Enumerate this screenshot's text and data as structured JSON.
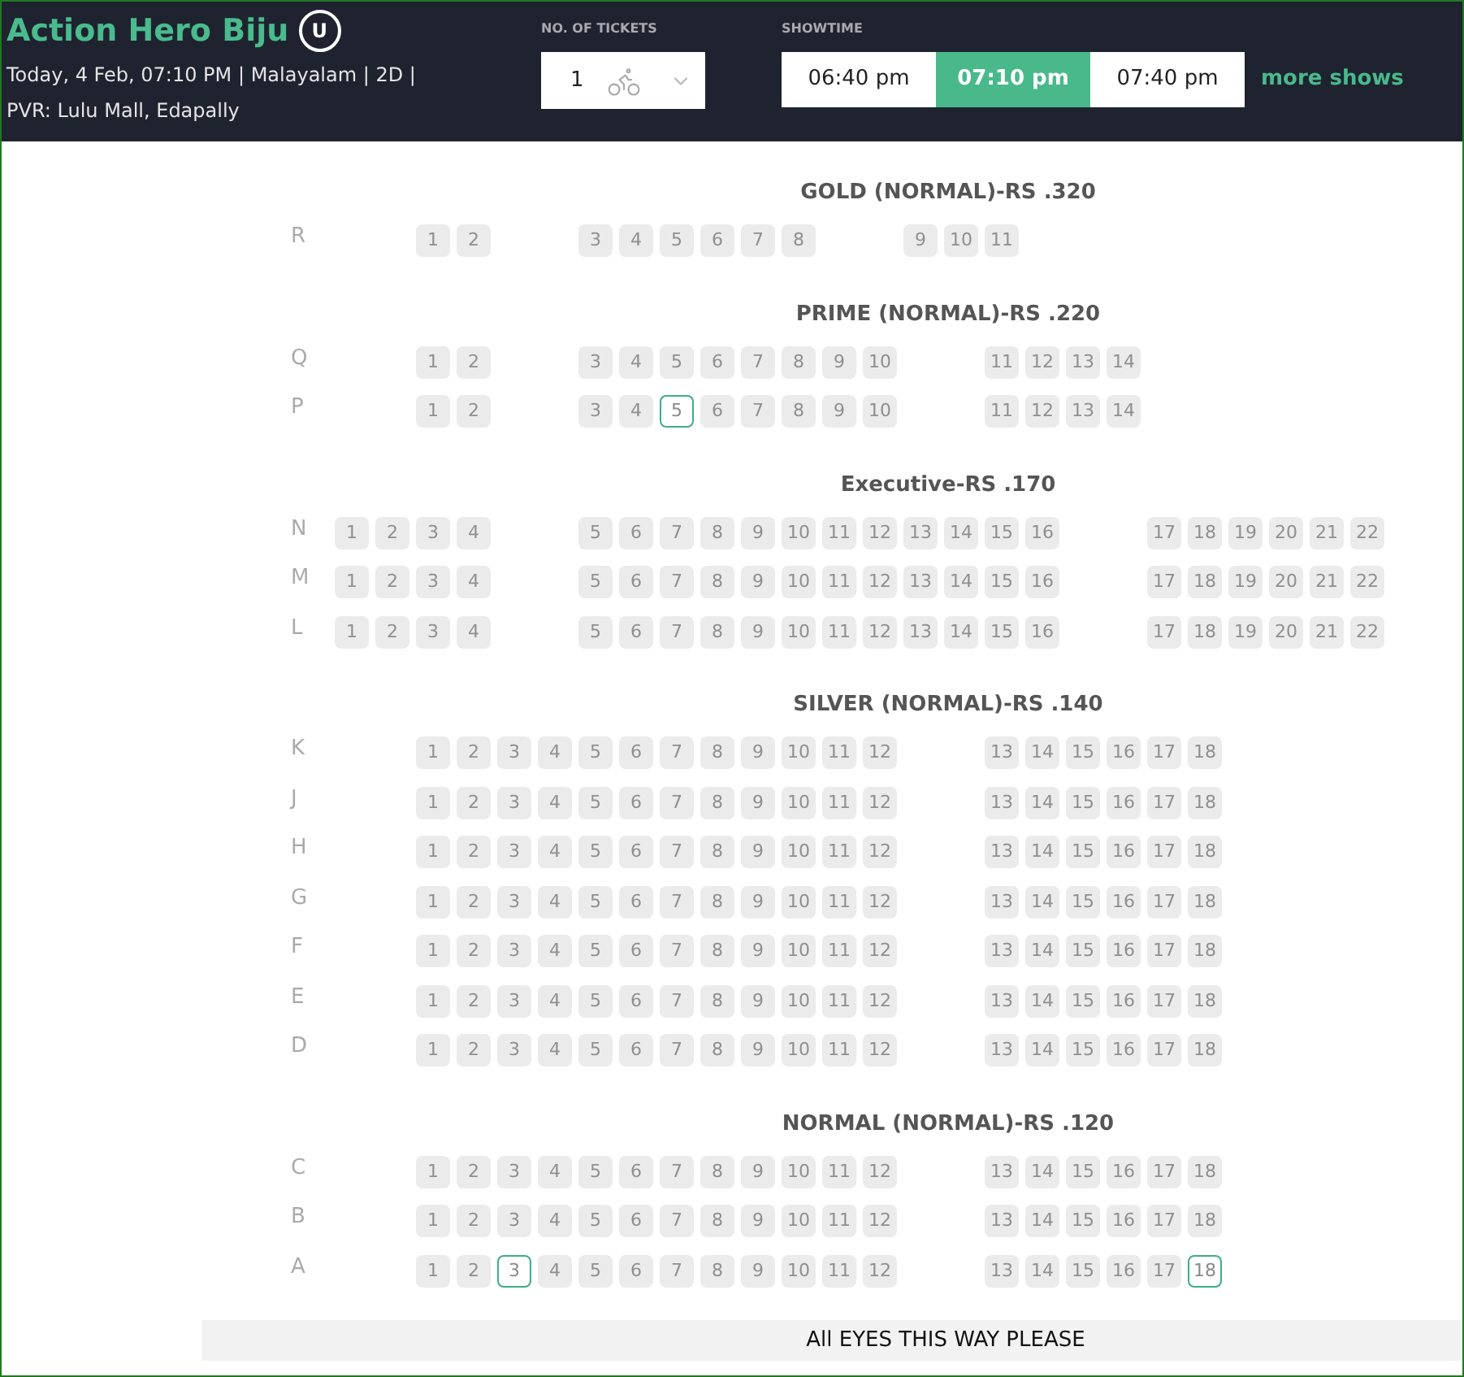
{
  "movie": {
    "title": "Action Hero Biju",
    "rating": "U",
    "details": "Today, 4 Feb, 07:10 PM | Malayalam | 2D |",
    "venue": "PVR: Lulu Mall, Edapally"
  },
  "tickets": {
    "label": "NO. OF TICKETS",
    "value": "1"
  },
  "showtime": {
    "label": "SHOWTIME",
    "times": [
      {
        "label": "06:40 pm",
        "selected": false
      },
      {
        "label": "07:10 pm",
        "selected": true
      },
      {
        "label": "07:40 pm",
        "selected": false
      }
    ],
    "more": "more shows"
  },
  "sections": [
    {
      "title": "GOLD (NORMAL)-RS .320",
      "rows": [
        {
          "label": "R",
          "blocks": [
            [
              {
                "n": "1",
                "available": false
              },
              {
                "n": "2",
                "available": false
              }
            ],
            [
              {
                "n": "3",
                "available": false
              },
              {
                "n": "4",
                "available": false
              },
              {
                "n": "5",
                "available": false
              },
              {
                "n": "6",
                "available": false
              },
              {
                "n": "7",
                "available": false
              },
              {
                "n": "8",
                "available": false
              }
            ],
            [
              {
                "n": "9",
                "available": false
              },
              {
                "n": "10",
                "available": false
              },
              {
                "n": "11",
                "available": false
              }
            ]
          ]
        }
      ]
    },
    {
      "title": "PRIME (NORMAL)-RS .220",
      "rows": [
        {
          "label": "Q",
          "blocks": [
            [
              {
                "n": "1",
                "available": false
              },
              {
                "n": "2",
                "available": false
              }
            ],
            [
              {
                "n": "3",
                "available": false
              },
              {
                "n": "4",
                "available": false
              },
              {
                "n": "5",
                "available": false
              },
              {
                "n": "6",
                "available": false
              },
              {
                "n": "7",
                "available": false
              },
              {
                "n": "8",
                "available": false
              },
              {
                "n": "9",
                "available": false
              },
              {
                "n": "10",
                "available": false
              }
            ],
            [
              {
                "n": "11",
                "available": false
              },
              {
                "n": "12",
                "available": false
              },
              {
                "n": "13",
                "available": false
              },
              {
                "n": "14",
                "available": false
              }
            ]
          ]
        },
        {
          "label": "P",
          "blocks": [
            [
              {
                "n": "1",
                "available": false
              },
              {
                "n": "2",
                "available": false
              }
            ],
            [
              {
                "n": "3",
                "available": false
              },
              {
                "n": "4",
                "available": false
              },
              {
                "n": "5",
                "available": true
              },
              {
                "n": "6",
                "available": false
              },
              {
                "n": "7",
                "available": false
              },
              {
                "n": "8",
                "available": false
              },
              {
                "n": "9",
                "available": false
              },
              {
                "n": "10",
                "available": false
              }
            ],
            [
              {
                "n": "11",
                "available": false
              },
              {
                "n": "12",
                "available": false
              },
              {
                "n": "13",
                "available": false
              },
              {
                "n": "14",
                "available": false
              }
            ]
          ]
        }
      ]
    },
    {
      "title": "Executive-RS .170",
      "rows": [
        {
          "label": "N",
          "blocks": [
            [
              {
                "n": "1",
                "available": false
              },
              {
                "n": "2",
                "available": false
              },
              {
                "n": "3",
                "available": false
              },
              {
                "n": "4",
                "available": false
              }
            ],
            [
              {
                "n": "5",
                "available": false
              },
              {
                "n": "6",
                "available": false
              },
              {
                "n": "7",
                "available": false
              },
              {
                "n": "8",
                "available": false
              },
              {
                "n": "9",
                "available": false
              },
              {
                "n": "10",
                "available": false
              },
              {
                "n": "11",
                "available": false
              },
              {
                "n": "12",
                "available": false
              },
              {
                "n": "13",
                "available": false
              },
              {
                "n": "14",
                "available": false
              },
              {
                "n": "15",
                "available": false
              },
              {
                "n": "16",
                "available": false
              }
            ],
            [
              {
                "n": "17",
                "available": false
              },
              {
                "n": "18",
                "available": false
              },
              {
                "n": "19",
                "available": false
              },
              {
                "n": "20",
                "available": false
              },
              {
                "n": "21",
                "available": false
              },
              {
                "n": "22",
                "available": false
              }
            ]
          ]
        },
        {
          "label": "M",
          "blocks": [
            [
              {
                "n": "1",
                "available": false
              },
              {
                "n": "2",
                "available": false
              },
              {
                "n": "3",
                "available": false
              },
              {
                "n": "4",
                "available": false
              }
            ],
            [
              {
                "n": "5",
                "available": false
              },
              {
                "n": "6",
                "available": false
              },
              {
                "n": "7",
                "available": false
              },
              {
                "n": "8",
                "available": false
              },
              {
                "n": "9",
                "available": false
              },
              {
                "n": "10",
                "available": false
              },
              {
                "n": "11",
                "available": false
              },
              {
                "n": "12",
                "available": false
              },
              {
                "n": "13",
                "available": false
              },
              {
                "n": "14",
                "available": false
              },
              {
                "n": "15",
                "available": false
              },
              {
                "n": "16",
                "available": false
              }
            ],
            [
              {
                "n": "17",
                "available": false
              },
              {
                "n": "18",
                "available": false
              },
              {
                "n": "19",
                "available": false
              },
              {
                "n": "20",
                "available": false
              },
              {
                "n": "21",
                "available": false
              },
              {
                "n": "22",
                "available": false
              }
            ]
          ]
        },
        {
          "label": "L",
          "blocks": [
            [
              {
                "n": "1",
                "available": false
              },
              {
                "n": "2",
                "available": false
              },
              {
                "n": "3",
                "available": false
              },
              {
                "n": "4",
                "available": false
              }
            ],
            [
              {
                "n": "5",
                "available": false
              },
              {
                "n": "6",
                "available": false
              },
              {
                "n": "7",
                "available": false
              },
              {
                "n": "8",
                "available": false
              },
              {
                "n": "9",
                "available": false
              },
              {
                "n": "10",
                "available": false
              },
              {
                "n": "11",
                "available": false
              },
              {
                "n": "12",
                "available": false
              },
              {
                "n": "13",
                "available": false
              },
              {
                "n": "14",
                "available": false
              },
              {
                "n": "15",
                "available": false
              },
              {
                "n": "16",
                "available": false
              }
            ],
            [
              {
                "n": "17",
                "available": false
              },
              {
                "n": "18",
                "available": false
              },
              {
                "n": "19",
                "available": false
              },
              {
                "n": "20",
                "available": false
              },
              {
                "n": "21",
                "available": false
              },
              {
                "n": "22",
                "available": false
              }
            ]
          ]
        }
      ]
    },
    {
      "title": "SILVER (NORMAL)-RS .140",
      "rows": [
        {
          "label": "K",
          "blocks": [
            [
              {
                "n": "1",
                "available": false
              },
              {
                "n": "2",
                "available": false
              },
              {
                "n": "3",
                "available": false
              },
              {
                "n": "4",
                "available": false
              },
              {
                "n": "5",
                "available": false
              },
              {
                "n": "6",
                "available": false
              },
              {
                "n": "7",
                "available": false
              },
              {
                "n": "8",
                "available": false
              },
              {
                "n": "9",
                "available": false
              },
              {
                "n": "10",
                "available": false
              },
              {
                "n": "11",
                "available": false
              },
              {
                "n": "12",
                "available": false
              }
            ],
            [
              {
                "n": "13",
                "available": false
              },
              {
                "n": "14",
                "available": false
              },
              {
                "n": "15",
                "available": false
              },
              {
                "n": "16",
                "available": false
              },
              {
                "n": "17",
                "available": false
              },
              {
                "n": "18",
                "available": false
              }
            ]
          ]
        },
        {
          "label": "J",
          "blocks": [
            [
              {
                "n": "1",
                "available": false
              },
              {
                "n": "2",
                "available": false
              },
              {
                "n": "3",
                "available": false
              },
              {
                "n": "4",
                "available": false
              },
              {
                "n": "5",
                "available": false
              },
              {
                "n": "6",
                "available": false
              },
              {
                "n": "7",
                "available": false
              },
              {
                "n": "8",
                "available": false
              },
              {
                "n": "9",
                "available": false
              },
              {
                "n": "10",
                "available": false
              },
              {
                "n": "11",
                "available": false
              },
              {
                "n": "12",
                "available": false
              }
            ],
            [
              {
                "n": "13",
                "available": false
              },
              {
                "n": "14",
                "available": false
              },
              {
                "n": "15",
                "available": false
              },
              {
                "n": "16",
                "available": false
              },
              {
                "n": "17",
                "available": false
              },
              {
                "n": "18",
                "available": false
              }
            ]
          ]
        },
        {
          "label": "H",
          "blocks": [
            [
              {
                "n": "1",
                "available": false
              },
              {
                "n": "2",
                "available": false
              },
              {
                "n": "3",
                "available": false
              },
              {
                "n": "4",
                "available": false
              },
              {
                "n": "5",
                "available": false
              },
              {
                "n": "6",
                "available": false
              },
              {
                "n": "7",
                "available": false
              },
              {
                "n": "8",
                "available": false
              },
              {
                "n": "9",
                "available": false
              },
              {
                "n": "10",
                "available": false
              },
              {
                "n": "11",
                "available": false
              },
              {
                "n": "12",
                "available": false
              }
            ],
            [
              {
                "n": "13",
                "available": false
              },
              {
                "n": "14",
                "available": false
              },
              {
                "n": "15",
                "available": false
              },
              {
                "n": "16",
                "available": false
              },
              {
                "n": "17",
                "available": false
              },
              {
                "n": "18",
                "available": false
              }
            ]
          ]
        },
        {
          "label": "G",
          "blocks": [
            [
              {
                "n": "1",
                "available": false
              },
              {
                "n": "2",
                "available": false
              },
              {
                "n": "3",
                "available": false
              },
              {
                "n": "4",
                "available": false
              },
              {
                "n": "5",
                "available": false
              },
              {
                "n": "6",
                "available": false
              },
              {
                "n": "7",
                "available": false
              },
              {
                "n": "8",
                "available": false
              },
              {
                "n": "9",
                "available": false
              },
              {
                "n": "10",
                "available": false
              },
              {
                "n": "11",
                "available": false
              },
              {
                "n": "12",
                "available": false
              }
            ],
            [
              {
                "n": "13",
                "available": false
              },
              {
                "n": "14",
                "available": false
              },
              {
                "n": "15",
                "available": false
              },
              {
                "n": "16",
                "available": false
              },
              {
                "n": "17",
                "available": false
              },
              {
                "n": "18",
                "available": false
              }
            ]
          ]
        },
        {
          "label": "F",
          "blocks": [
            [
              {
                "n": "1",
                "available": false
              },
              {
                "n": "2",
                "available": false
              },
              {
                "n": "3",
                "available": false
              },
              {
                "n": "4",
                "available": false
              },
              {
                "n": "5",
                "available": false
              },
              {
                "n": "6",
                "available": false
              },
              {
                "n": "7",
                "available": false
              },
              {
                "n": "8",
                "available": false
              },
              {
                "n": "9",
                "available": false
              },
              {
                "n": "10",
                "available": false
              },
              {
                "n": "11",
                "available": false
              },
              {
                "n": "12",
                "available": false
              }
            ],
            [
              {
                "n": "13",
                "available": false
              },
              {
                "n": "14",
                "available": false
              },
              {
                "n": "15",
                "available": false
              },
              {
                "n": "16",
                "available": false
              },
              {
                "n": "17",
                "available": false
              },
              {
                "n": "18",
                "available": false
              }
            ]
          ]
        },
        {
          "label": "E",
          "blocks": [
            [
              {
                "n": "1",
                "available": false
              },
              {
                "n": "2",
                "available": false
              },
              {
                "n": "3",
                "available": false
              },
              {
                "n": "4",
                "available": false
              },
              {
                "n": "5",
                "available": false
              },
              {
                "n": "6",
                "available": false
              },
              {
                "n": "7",
                "available": false
              },
              {
                "n": "8",
                "available": false
              },
              {
                "n": "9",
                "available": false
              },
              {
                "n": "10",
                "available": false
              },
              {
                "n": "11",
                "available": false
              },
              {
                "n": "12",
                "available": false
              }
            ],
            [
              {
                "n": "13",
                "available": false
              },
              {
                "n": "14",
                "available": false
              },
              {
                "n": "15",
                "available": false
              },
              {
                "n": "16",
                "available": false
              },
              {
                "n": "17",
                "available": false
              },
              {
                "n": "18",
                "available": false
              }
            ]
          ]
        },
        {
          "label": "D",
          "blocks": [
            [
              {
                "n": "1",
                "available": false
              },
              {
                "n": "2",
                "available": false
              },
              {
                "n": "3",
                "available": false
              },
              {
                "n": "4",
                "available": false
              },
              {
                "n": "5",
                "available": false
              },
              {
                "n": "6",
                "available": false
              },
              {
                "n": "7",
                "available": false
              },
              {
                "n": "8",
                "available": false
              },
              {
                "n": "9",
                "available": false
              },
              {
                "n": "10",
                "available": false
              },
              {
                "n": "11",
                "available": false
              },
              {
                "n": "12",
                "available": false
              }
            ],
            [
              {
                "n": "13",
                "available": false
              },
              {
                "n": "14",
                "available": false
              },
              {
                "n": "15",
                "available": false
              },
              {
                "n": "16",
                "available": false
              },
              {
                "n": "17",
                "available": false
              },
              {
                "n": "18",
                "available": false
              }
            ]
          ]
        }
      ]
    },
    {
      "title": "NORMAL (NORMAL)-RS .120",
      "rows": [
        {
          "label": "C",
          "blocks": [
            [
              {
                "n": "1",
                "available": false
              },
              {
                "n": "2",
                "available": false
              },
              {
                "n": "3",
                "available": false
              },
              {
                "n": "4",
                "available": false
              },
              {
                "n": "5",
                "available": false
              },
              {
                "n": "6",
                "available": false
              },
              {
                "n": "7",
                "available": false
              },
              {
                "n": "8",
                "available": false
              },
              {
                "n": "9",
                "available": false
              },
              {
                "n": "10",
                "available": false
              },
              {
                "n": "11",
                "available": false
              },
              {
                "n": "12",
                "available": false
              }
            ],
            [
              {
                "n": "13",
                "available": false
              },
              {
                "n": "14",
                "available": false
              },
              {
                "n": "15",
                "available": false
              },
              {
                "n": "16",
                "available": false
              },
              {
                "n": "17",
                "available": false
              },
              {
                "n": "18",
                "available": false
              }
            ]
          ]
        },
        {
          "label": "B",
          "blocks": [
            [
              {
                "n": "1",
                "available": false
              },
              {
                "n": "2",
                "available": false
              },
              {
                "n": "3",
                "available": false
              },
              {
                "n": "4",
                "available": false
              },
              {
                "n": "5",
                "available": false
              },
              {
                "n": "6",
                "available": false
              },
              {
                "n": "7",
                "available": false
              },
              {
                "n": "8",
                "available": false
              },
              {
                "n": "9",
                "available": false
              },
              {
                "n": "10",
                "available": false
              },
              {
                "n": "11",
                "available": false
              },
              {
                "n": "12",
                "available": false
              }
            ],
            [
              {
                "n": "13",
                "available": false
              },
              {
                "n": "14",
                "available": false
              },
              {
                "n": "15",
                "available": false
              },
              {
                "n": "16",
                "available": false
              },
              {
                "n": "17",
                "available": false
              },
              {
                "n": "18",
                "available": false
              }
            ]
          ]
        },
        {
          "label": "A",
          "blocks": [
            [
              {
                "n": "1",
                "available": false
              },
              {
                "n": "2",
                "available": false
              },
              {
                "n": "3",
                "available": true
              },
              {
                "n": "4",
                "available": false
              },
              {
                "n": "5",
                "available": false
              },
              {
                "n": "6",
                "available": false
              },
              {
                "n": "7",
                "available": false
              },
              {
                "n": "8",
                "available": false
              },
              {
                "n": "9",
                "available": false
              },
              {
                "n": "10",
                "available": false
              },
              {
                "n": "11",
                "available": false
              },
              {
                "n": "12",
                "available": false
              }
            ],
            [
              {
                "n": "13",
                "available": false
              },
              {
                "n": "14",
                "available": false
              },
              {
                "n": "15",
                "available": false
              },
              {
                "n": "16",
                "available": false
              },
              {
                "n": "17",
                "available": false
              },
              {
                "n": "18",
                "available": true
              }
            ]
          ]
        }
      ]
    }
  ],
  "screen": "All EYES THIS WAY PLEASE"
}
